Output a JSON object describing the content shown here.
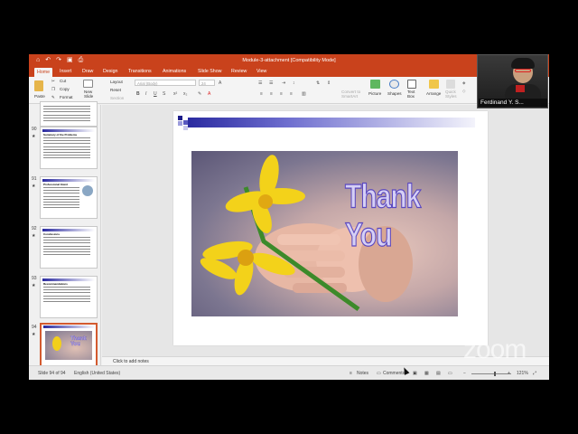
{
  "window": {
    "title": "Module-3-attachment [Compatibility Mode]",
    "quick_icons": [
      "home-icon",
      "undo-icon",
      "redo-icon",
      "save-icon",
      "print-icon"
    ]
  },
  "tabs": [
    "Home",
    "Insert",
    "Draw",
    "Design",
    "Transitions",
    "Animations",
    "Slide Show",
    "Review",
    "View"
  ],
  "active_tab": "Home",
  "ribbon": {
    "paste": "Paste",
    "cut": "Cut",
    "copy": "Copy",
    "format": "Format",
    "new_slide": "New\nSlide",
    "layout": "Layout",
    "reset": "Reset",
    "section": "Section",
    "font_name": "Arial (Body)",
    "font_size": "24",
    "convert_smartart": "Convert to\nSmartArt",
    "picture": "Picture",
    "shapes": "Shapes",
    "text_box": "Text\nBox",
    "arrange": "Arrange",
    "quick_styles": "Quick\nStyles"
  },
  "slides": [
    {
      "number": "",
      "title": "",
      "starred": false
    },
    {
      "number": "90",
      "title": "Summary of the Problems",
      "starred": true
    },
    {
      "number": "91",
      "title": "Professional Intent",
      "starred": true
    },
    {
      "number": "92",
      "title": "Conclusions",
      "starred": true
    },
    {
      "number": "93",
      "title": "Recommendations",
      "starred": true
    },
    {
      "number": "94",
      "title": "Thank You",
      "starred": true
    }
  ],
  "current_slide": {
    "title_art": "Thank You"
  },
  "notes": {
    "placeholder": "Click to add notes"
  },
  "status": {
    "slide_info": "Slide 94 of 94",
    "language": "English (United States)",
    "notes_btn": "Notes",
    "comments_btn": "Comments",
    "zoom_level": "121%"
  },
  "participant": {
    "name": "Ferdinand Y. S..."
  },
  "zoom_watermark": "zoom",
  "colors": {
    "accent": "#c9421c",
    "slide_bar": "#2a2aa0",
    "wordart": "#5a48c0"
  }
}
